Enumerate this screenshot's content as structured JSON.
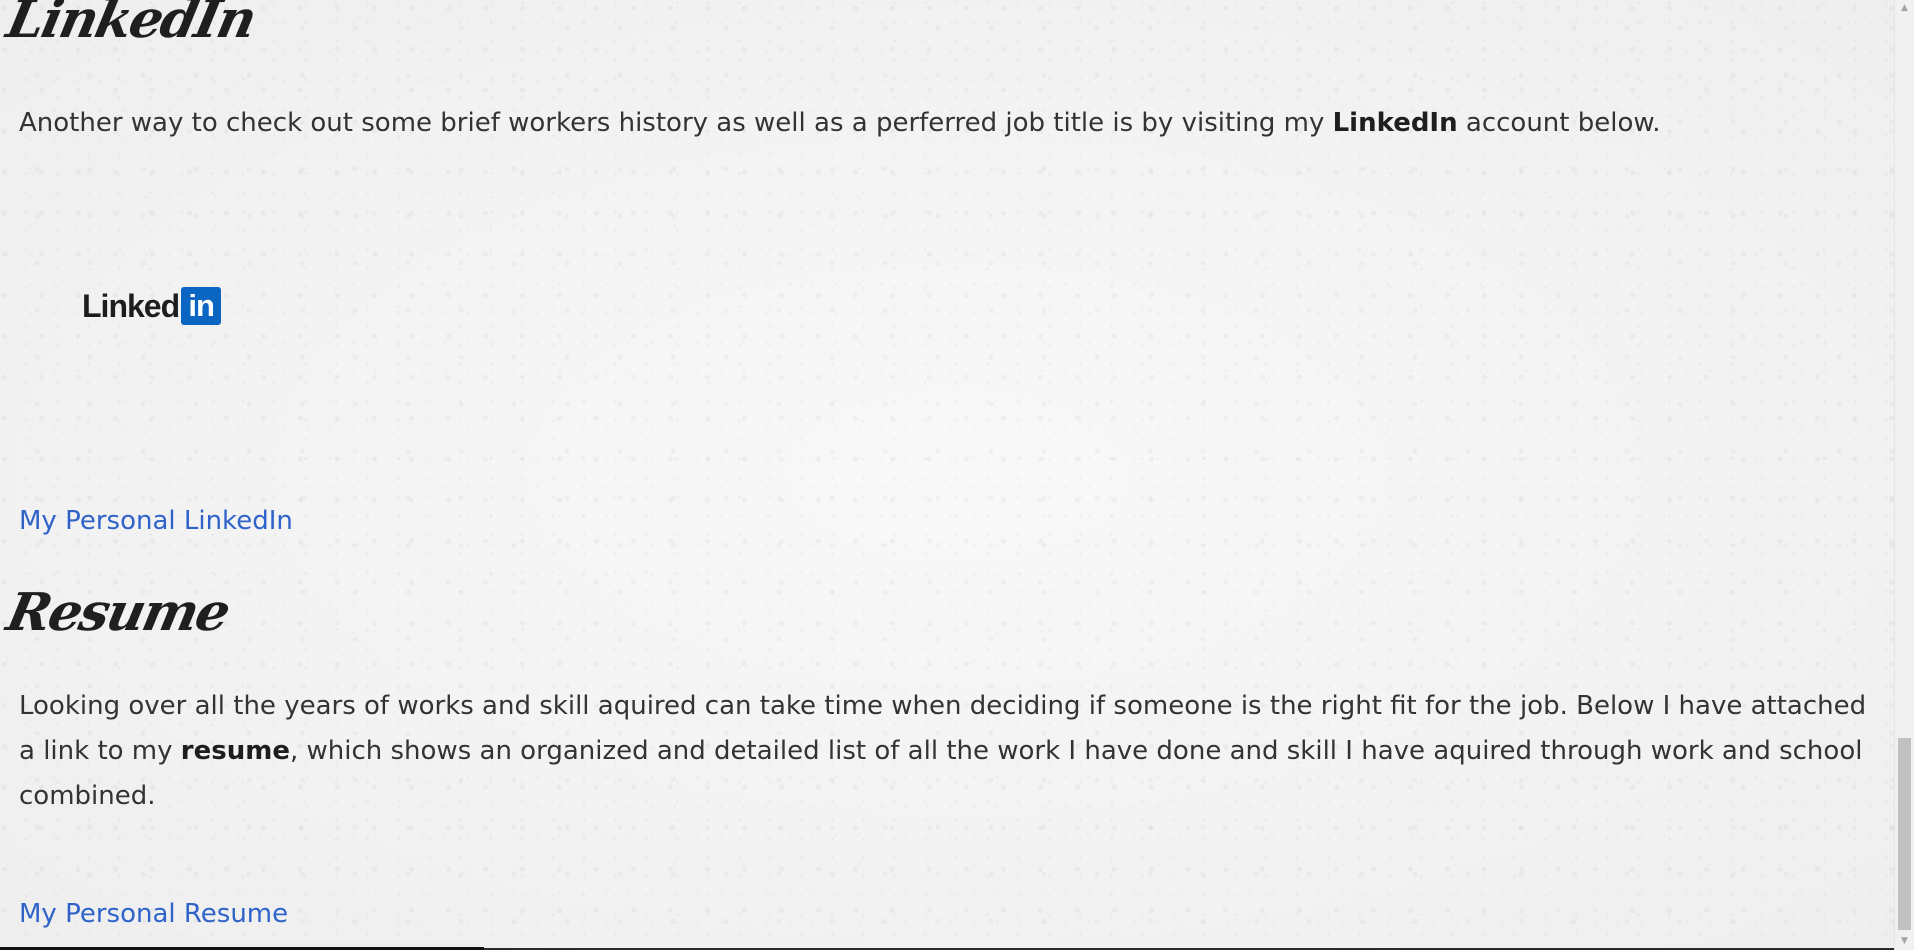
{
  "linkedin_section": {
    "heading": "LinkedIn",
    "paragraph_before": "Another way to check out some brief workers history as well as a perferred job title is by visiting my ",
    "paragraph_bold": "LinkedIn",
    "paragraph_after": " account below.",
    "logo_word": "Linked",
    "logo_box": "in",
    "link_text": "My Personal LinkedIn"
  },
  "resume_section": {
    "heading": "Resume",
    "paragraph_before": "Looking over all the years of works and skill aquired can take time when deciding if someone is the right fit for the job. Below I have attached a link to my ",
    "paragraph_bold": "resume",
    "paragraph_after": ", which shows an organized and detailed list of all the work I have done and skill I have aquired through work and school combined.",
    "link_text": "My Personal Resume"
  },
  "scrollbar": {
    "up_icon": "chevron-up-icon",
    "down_icon": "chevron-down-icon",
    "position_fraction": 0.95
  },
  "colors": {
    "link": "#2f63c9",
    "text": "#333333",
    "linkedin_brand": "#0a66c2",
    "background": "#efefef"
  }
}
